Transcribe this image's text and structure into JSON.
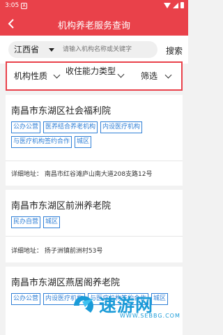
{
  "status_bar": {
    "time": "3:05",
    "badge": "A"
  },
  "header": {
    "title": "机构养老服务查询"
  },
  "search": {
    "province": "江西省",
    "placeholder": "请输入机构名称或关键字",
    "button": "搜索"
  },
  "filters": [
    {
      "label": "机构性质"
    },
    {
      "label": "收住能力类型"
    },
    {
      "label": "筛选"
    }
  ],
  "cards": [
    {
      "name": "南昌市东湖区社会福利院",
      "tags": [
        "公办公营",
        "医养结合养老机构",
        "内设医疗机构",
        "与医疗机构签约合作",
        "城区"
      ],
      "address": "详细地址：  南昌市红谷滩庐山南大道208支路12号"
    },
    {
      "name": "南昌市东湖区前洲养老院",
      "tags": [
        "民办自营",
        "城区"
      ],
      "address": "详细地址：  扬子洲镇前洲村53号"
    },
    {
      "name": "南昌市东湖区燕居阁养老院",
      "tags": [
        "公办公营",
        "内设医疗机构",
        "与医疗机构签约合作",
        "城区"
      ]
    }
  ],
  "watermark": {
    "text": "速游网",
    "url": "WWW.SEBBG.COM"
  },
  "colors": {
    "brand": "#e9414a",
    "tag": "#2f7fd6",
    "watermark": "#1a9bd8"
  }
}
